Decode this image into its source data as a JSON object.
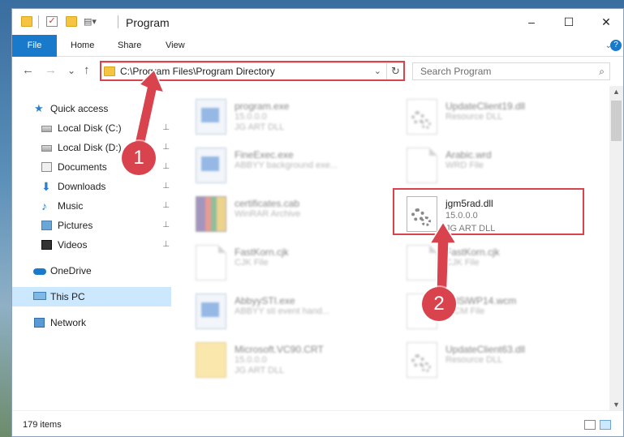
{
  "window": {
    "title": "Program",
    "controls": {
      "minimize": "–",
      "maximize": "☐",
      "close": "✕"
    }
  },
  "ribbon": {
    "tabs": [
      "File",
      "Home",
      "Share",
      "View"
    ],
    "expand_glyph": "⌄",
    "help_glyph": "?"
  },
  "nav": {
    "back": "←",
    "forward": "→",
    "recent": "⌄",
    "up": "↑",
    "address": "C:\\Program Files\\Program Directory",
    "dropdown": "⌄",
    "refresh": "↻",
    "search_placeholder": "Search Program",
    "search_glyph": "⌕"
  },
  "sidebar": {
    "items": [
      {
        "label": "Quick access",
        "icon": "star-icon",
        "pinned": false
      },
      {
        "label": "Local Disk (C:)",
        "icon": "drive-icon",
        "pinned": true
      },
      {
        "label": "Local Disk (D:)",
        "icon": "drive-icon",
        "pinned": true
      },
      {
        "label": "Documents",
        "icon": "documents-icon",
        "pinned": true
      },
      {
        "label": "Downloads",
        "icon": "downloads-icon",
        "pinned": true
      },
      {
        "label": "Music",
        "icon": "music-icon",
        "pinned": true
      },
      {
        "label": "Pictures",
        "icon": "pictures-icon",
        "pinned": true
      },
      {
        "label": "Videos",
        "icon": "videos-icon",
        "pinned": true
      },
      {
        "label": "OneDrive",
        "icon": "onedrive-icon",
        "pinned": false
      },
      {
        "label": "This PC",
        "icon": "this-pc-icon",
        "pinned": false,
        "selected": true
      },
      {
        "label": "Network",
        "icon": "network-icon",
        "pinned": false
      }
    ],
    "pin_glyph": "📌"
  },
  "files": [
    {
      "name": "program.exe",
      "line2": "15.0.0.0",
      "line3": "JG ART DLL",
      "icon": "exe-icon",
      "blurred": true
    },
    {
      "name": "UpdateClient19.dll",
      "line2": "Resource DLL",
      "line3": "",
      "icon": "gear-file-icon",
      "blurred": true
    },
    {
      "name": "FineExec.exe",
      "line2": "ABBYY background exe...",
      "line3": "",
      "icon": "exe-icon",
      "blurred": true
    },
    {
      "name": "Arabic.wrd",
      "line2": "WRD File",
      "line3": "",
      "icon": "generic-file-icon",
      "blurred": true
    },
    {
      "name": "certificates.cab",
      "line2": "WinRAR Archive",
      "line3": "",
      "icon": "winrar-icon",
      "blurred": true
    },
    {
      "name": "jgm5rad.dll",
      "line2": "15.0.0.0",
      "line3": "JG ART DLL",
      "icon": "gear-file-icon",
      "blurred": false
    },
    {
      "name": "FastKorn.cjk",
      "line2": "CJK File",
      "line3": "",
      "icon": "generic-file-icon",
      "blurred": true
    },
    {
      "name": "FastKorn.cjk",
      "line2": "CJK File",
      "line3": "",
      "icon": "generic-file-icon",
      "blurred": true
    },
    {
      "name": "AbbyySTI.exe",
      "line2": "ABBYY sti event hand...",
      "line3": "",
      "icon": "exe-icon",
      "blurred": true
    },
    {
      "name": "ItalSiWP14.wcm",
      "line2": "WCM File",
      "line3": "",
      "icon": "generic-file-icon",
      "blurred": true
    },
    {
      "name": "Microsoft.VC90.CRT",
      "line2": "15.0.0.0",
      "line3": "JG ART DLL",
      "icon": "folder-file-icon",
      "blurred": true
    },
    {
      "name": "UpdateClient63.dll",
      "line2": "Resource DLL",
      "line3": "",
      "icon": "gear-file-icon",
      "blurred": true
    }
  ],
  "status": {
    "item_count": "179 items"
  },
  "annotations": {
    "step1": "1",
    "step2": "2",
    "color": "#d9434e"
  }
}
